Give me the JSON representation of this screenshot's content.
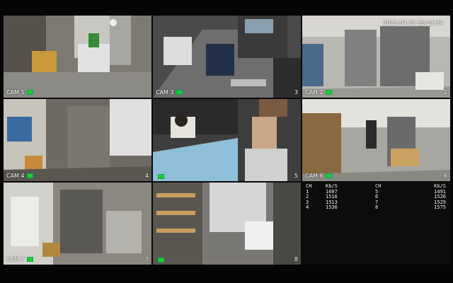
{
  "timestamp": "2022-04-28 16:03:34",
  "tiles": [
    {
      "cam": "CAM 1",
      "ch": ""
    },
    {
      "cam": "CAM 3",
      "ch": "3"
    },
    {
      "cam": "CAM 2",
      "ch": "2"
    },
    {
      "cam": "CAM 4",
      "ch": "4"
    },
    {
      "cam": "",
      "ch": "5"
    },
    {
      "cam": "CAM 6",
      "ch": "6"
    },
    {
      "cam": "CAM 7",
      "ch": "7"
    },
    {
      "cam": "",
      "ch": "8"
    }
  ],
  "bitrate": {
    "headers": [
      "CH",
      "Kb/S",
      "CH",
      "Kb/S"
    ],
    "rows": [
      [
        "1",
        "1607",
        "5",
        "1491"
      ],
      [
        "2",
        "1516",
        "6",
        "1526"
      ],
      [
        "3",
        "1513",
        "7",
        "1529"
      ],
      [
        "4",
        "1536",
        "8",
        "1575"
      ]
    ]
  },
  "colors": {
    "recording_indicator": "#22cc33",
    "background": "#000000"
  }
}
